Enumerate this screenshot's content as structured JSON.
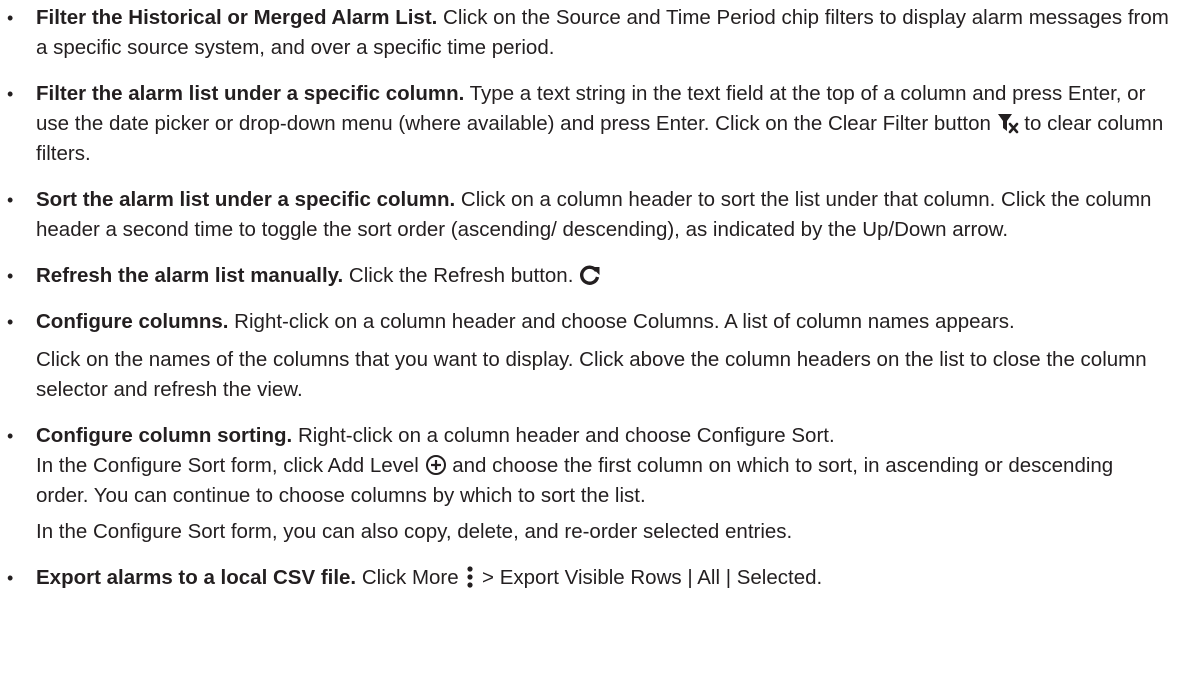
{
  "items": [
    {
      "title": "Filter the Historical or Merged Alarm List.",
      "text": " Click on the Source and Time Period chip filters to display alarm messages from a specific source system, and over a specific time period."
    },
    {
      "title": "Filter the alarm list under a specific column.",
      "text": " Type a text string in the text field at the top of a column and press Enter, or use the date picker or drop-down menu (where available) and press Enter. Click on the Clear Filter button ",
      "text_after": " to clear column filters."
    },
    {
      "title": "Sort the alarm list under a specific column.",
      "text": " Click on a column header to sort the list under that column. Click the column header a second time to toggle the sort order (ascending/ descending), as indicated by the Up/Down arrow."
    },
    {
      "title": "Refresh the alarm list manually.",
      "text": " Click the Refresh button. "
    },
    {
      "title": "Configure columns.",
      "text": " Right-click on a column header and choose Columns. A list of column names appears.",
      "para2": "Click on the names of the columns that you want to display. Click above the column headers on the list to close the column selector and refresh the view."
    },
    {
      "title": "Configure column sorting.",
      "text": " Right-click on a column header and choose Configure Sort.",
      "para2_before": "In the Configure Sort form, click Add Level ",
      "para2_after": " and choose the first column on which to sort, in ascending or descending order. You can continue to choose columns by which to sort the list.",
      "para3": "In the Configure Sort form, you can also copy, delete, and re-order selected entries."
    },
    {
      "title": "Export alarms to a local CSV file.",
      "text": " Click More ",
      "text_after": " > Export Visible Rows | All | Selected."
    }
  ],
  "bullet": "•",
  "icons": {
    "clear_filter": "clear-filter-icon",
    "refresh": "refresh-icon",
    "add_level": "add-circle-icon",
    "more": "more-vertical-icon"
  },
  "text_color": "#231f20"
}
